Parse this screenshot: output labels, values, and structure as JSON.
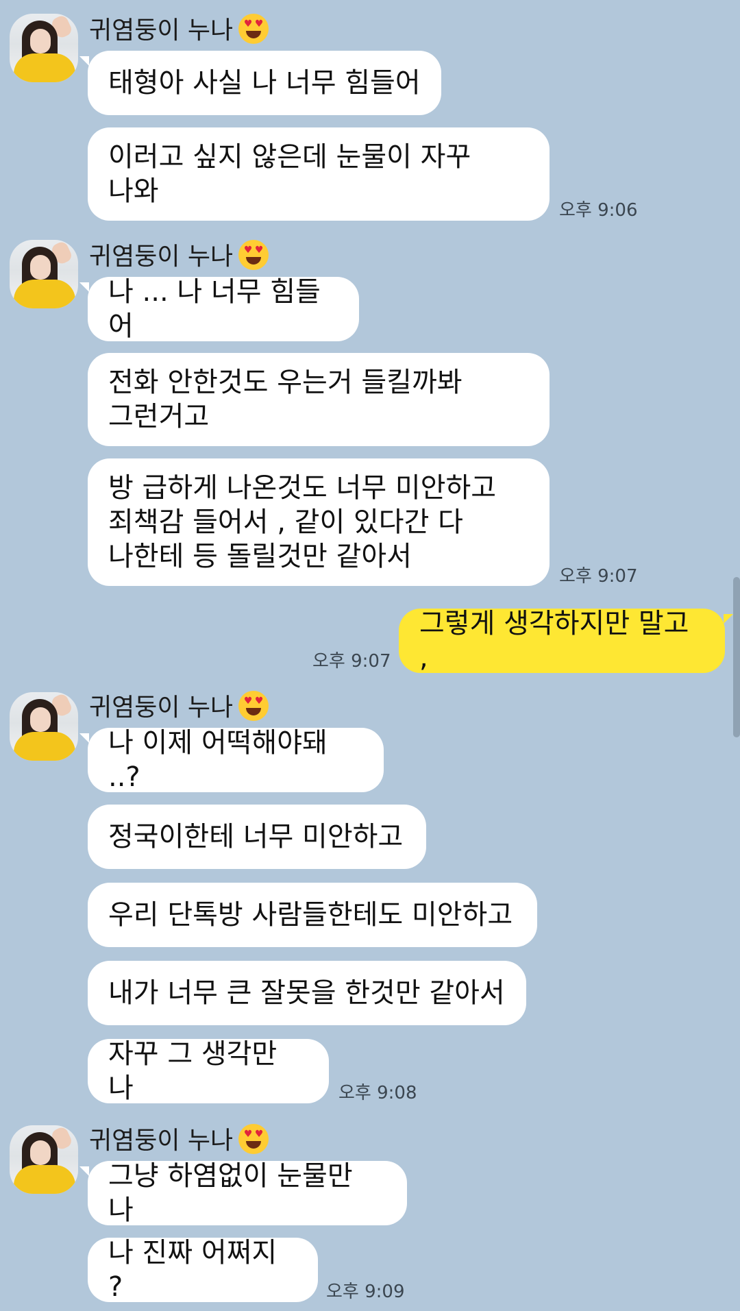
{
  "sender_name": "귀염둥이 누나",
  "groups": [
    {
      "messages": [
        {
          "text": "태형아 사실 나 너무 힘들어"
        },
        {
          "text": "이러고 싶지 않은데 눈물이 자꾸\n나와"
        }
      ],
      "time": "오후 9:06"
    },
    {
      "messages": [
        {
          "text": "나 ... 나 너무 힘들어"
        },
        {
          "text": "전화 안한것도 우는거 들킬까봐\n그런거고"
        },
        {
          "text": "방 급하게 나온것도 너무 미안하고\n죄책감 들어서 , 같이 있다간 다\n나한테 등 돌릴것만 같아서"
        }
      ],
      "time": "오후 9:07"
    },
    {
      "messages": [
        {
          "text": "나 이제 어떡해야돼 ..?"
        },
        {
          "text": "정국이한테 너무 미안하고"
        },
        {
          "text": "우리 단톡방 사람들한테도 미안하고"
        },
        {
          "text": "내가 너무 큰 잘못을 한것만 같아서"
        },
        {
          "text": "자꾸 그 생각만 나"
        }
      ],
      "time": "오후 9:08"
    },
    {
      "messages": [
        {
          "text": "그냥 하염없이 눈물만 나"
        },
        {
          "text": "나 진짜 어쩌지 ?"
        }
      ],
      "time": "오후 9:09"
    }
  ],
  "my_message": {
    "text": "그렇게 생각하지만 말고 ,",
    "time": "오후 9:07"
  },
  "colors": {
    "background": "#b2c7da",
    "other_bubble": "#ffffff",
    "my_bubble": "#fee733"
  }
}
